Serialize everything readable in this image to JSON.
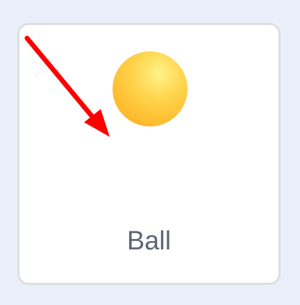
{
  "tile": {
    "label": "Ball",
    "icon": "ball-icon",
    "selected": false
  },
  "overlay": {
    "annotation_icon": "red-arrow-icon",
    "arrow_color": "#ff0000"
  }
}
